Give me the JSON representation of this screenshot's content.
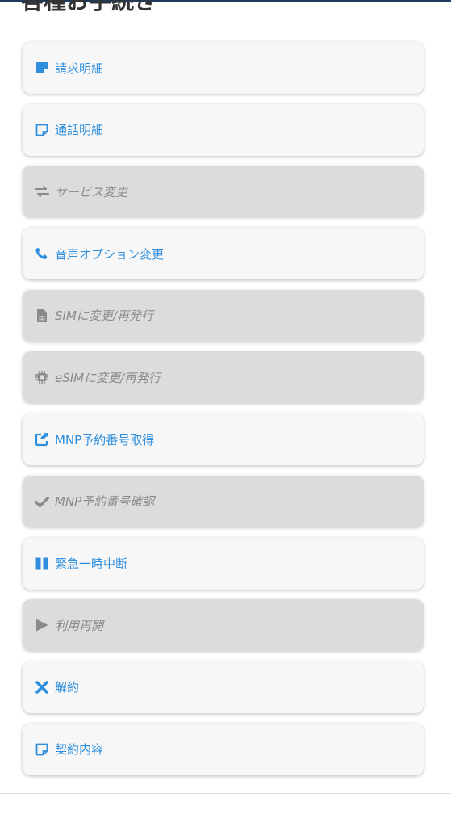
{
  "page": {
    "title": "各種お手続き"
  },
  "menu": {
    "items": [
      {
        "label": "請求明細",
        "icon": "note-filled-icon",
        "disabled": false
      },
      {
        "label": "通話明細",
        "icon": "note-outline-icon",
        "disabled": false
      },
      {
        "label": "サービス変更",
        "icon": "exchange-arrows-icon",
        "disabled": true
      },
      {
        "label": "音声オプション変更",
        "icon": "phone-icon",
        "disabled": false
      },
      {
        "label": "SIMに変更/再発行",
        "icon": "sim-card-icon",
        "disabled": true
      },
      {
        "label": "eSIMに変更/再発行",
        "icon": "chip-icon",
        "disabled": true
      },
      {
        "label": "MNP予約番号取得",
        "icon": "share-out-icon",
        "disabled": false
      },
      {
        "label": "MNP予約番号確認",
        "icon": "checkmark-icon",
        "disabled": true
      },
      {
        "label": "緊急一時中断",
        "icon": "pause-icon",
        "disabled": false
      },
      {
        "label": "利用再開",
        "icon": "play-icon",
        "disabled": true
      },
      {
        "label": "解約",
        "icon": "close-x-icon",
        "disabled": false
      },
      {
        "label": "契約内容",
        "icon": "note-outline-icon",
        "disabled": false
      }
    ]
  },
  "colors": {
    "accent": "#2f8fdc",
    "disabled_text": "#8a8a8a",
    "disabled_bg": "#dcdcdc",
    "enabled_bg": "#f7f7f7",
    "title": "#333333",
    "topbar": "#1e3a5f"
  }
}
